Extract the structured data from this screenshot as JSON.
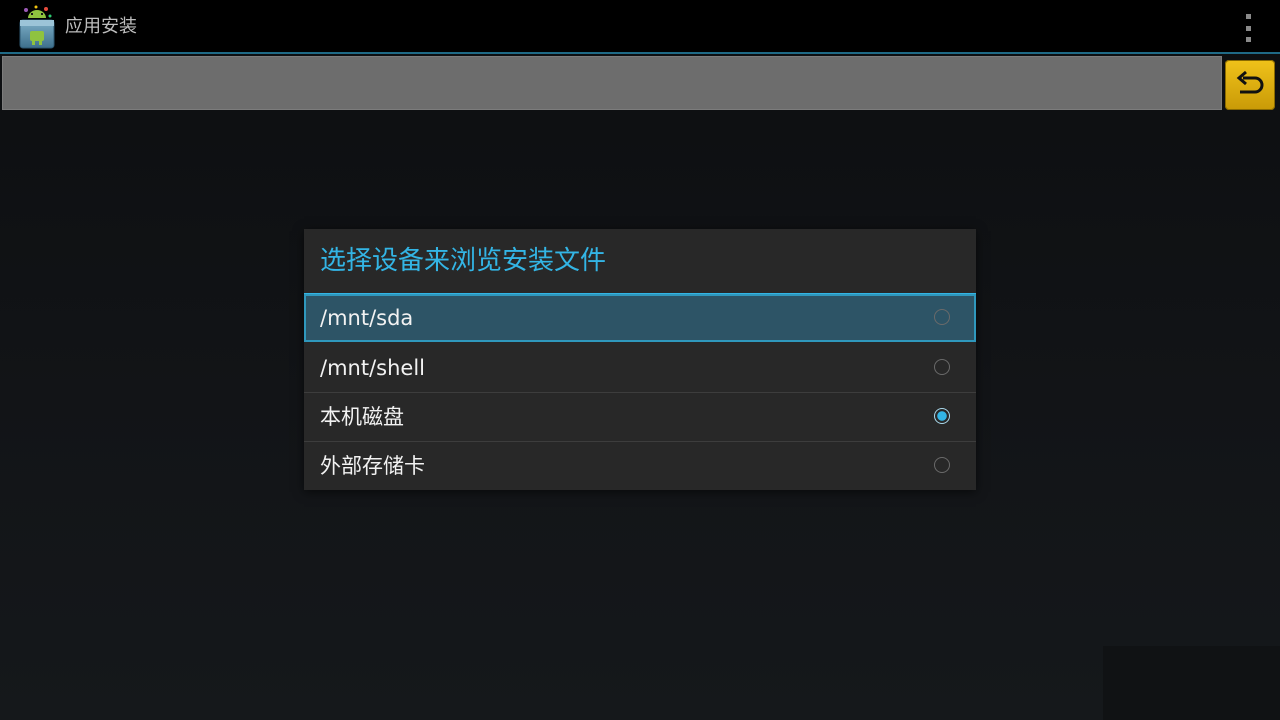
{
  "app": {
    "title": "应用安装",
    "icon": "android-package-icon",
    "menu_icon": "overflow-menu-icon"
  },
  "path_bar": {
    "value": "",
    "back_icon": "return-arrow-icon"
  },
  "dialog": {
    "title": "选择设备来浏览安装文件",
    "options": [
      {
        "label": "/mnt/sda",
        "checked": false
      },
      {
        "label": "/mnt/shell",
        "checked": false
      },
      {
        "label": "本机磁盘",
        "checked": true
      },
      {
        "label": "外部存储卡",
        "checked": false
      }
    ]
  },
  "colors": {
    "accent": "#33b5e5",
    "action_bar": "#000000",
    "dialog_bg": "#282828",
    "back_button": "#e6b411"
  }
}
